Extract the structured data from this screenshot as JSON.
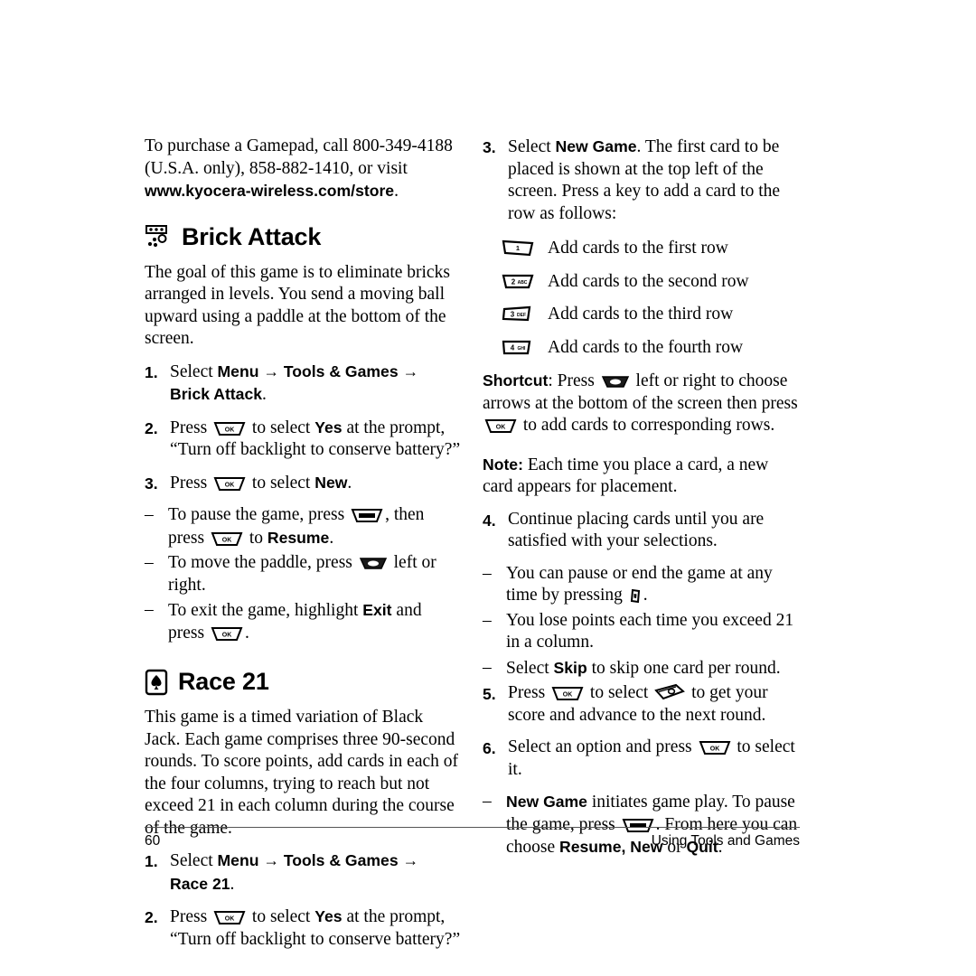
{
  "footer": {
    "page_number": "60",
    "running_head": "Using Tools and Games"
  },
  "left_column": {
    "intro": {
      "line1": "To purchase a Gamepad, call 800-349-4188",
      "line2": "(U.S.A. only), 858-882-1410, or visit",
      "url": "www.kyocera-wireless.com/store",
      "period": "."
    },
    "brick_attack": {
      "heading": "Brick Attack",
      "icon": "brick-attack-icon",
      "description": "The goal of this game is to eliminate bricks arranged in levels. You send a moving ball upward using a paddle at the bottom of the screen.",
      "steps": [
        {
          "marker": "1.",
          "pre": "Select ",
          "b1": "Menu",
          "arrow1": " → ",
          "b2": "Tools & Games",
          "arrow2": " → ",
          "b3": "Brick Attack",
          "post": "."
        },
        {
          "marker": "2.",
          "pre": "Press ",
          "key": "ok-key-icon",
          "mid": " to select ",
          "b1": "Yes",
          "post": " at the prompt, “Turn off backlight to conserve battery?”"
        },
        {
          "marker": "3.",
          "pre": "Press ",
          "key": "ok-key-icon",
          "mid": " to select ",
          "b1": "New",
          "post": "."
        }
      ],
      "sub_bullets": [
        {
          "marker": "–",
          "pre": "To pause the game, press ",
          "key1": "back-key-icon",
          "mid1": ", then press ",
          "key2": "ok-key-icon",
          "mid2": " to ",
          "b1": "Resume",
          "post": "."
        },
        {
          "marker": "–",
          "pre": "To move the paddle, press ",
          "key1": "nav-key-icon",
          "post": " left or right."
        },
        {
          "marker": "–",
          "pre": "To exit the game, highlight ",
          "b1": "Exit",
          "mid1": " and press ",
          "key1": "ok-key-icon",
          "post": "."
        }
      ]
    },
    "race21": {
      "heading": "Race 21",
      "icon": "spade-card-icon",
      "description": "This game is a timed variation of Black Jack. Each game comprises three 90-second rounds. To score points, add cards in each of the four columns, trying to reach but not exceed 21 in each column during the course of the game.",
      "steps": [
        {
          "marker": "1.",
          "pre": "Select ",
          "b1": "Menu",
          "arrow1": " → ",
          "b2": "Tools & Games",
          "arrow2": " → ",
          "b3": "Race 21",
          "post": "."
        },
        {
          "marker": "2.",
          "pre": "Press ",
          "key": "ok-key-icon",
          "mid": " to select ",
          "b1": "Yes",
          "post": " at the prompt, “Turn off backlight to conserve battery?”"
        }
      ]
    }
  },
  "right_column": {
    "step3": {
      "marker": "3.",
      "pre": "Select ",
      "b1": "New Game",
      "post": ". The first card to be placed is shown at the top left of the screen. Press a key to add a card to the row as follows:"
    },
    "key_rows": [
      {
        "key": "key-1-icon",
        "digit": "1",
        "sub": "",
        "text": "Add cards to the first row"
      },
      {
        "key": "key-2-icon",
        "digit": "2",
        "sub": "ABC",
        "text": "Add cards to the second row"
      },
      {
        "key": "key-3-icon",
        "digit": "3",
        "sub": "DEF",
        "text": "Add cards to the third row"
      },
      {
        "key": "key-4-icon",
        "digit": "4",
        "sub": "GHI",
        "text": "Add cards to the fourth row"
      }
    ],
    "shortcut": {
      "label": "Shortcut",
      "colon": ": Press ",
      "key1": "nav-key-icon",
      "mid": " left or right to choose arrows at the bottom of the screen then press ",
      "key2": "ok-key-icon",
      "post": " to add cards to corresponding rows."
    },
    "note": {
      "label": "Note:",
      "text": " Each time you place a card, a new card appears for placement."
    },
    "step4": {
      "marker": "4.",
      "text": "Continue placing cards until you are satisfied with your selections."
    },
    "step4_bullets": [
      {
        "marker": "–",
        "pre": "You can pause or end the game at any time by pressing ",
        "key1": "end-key-icon",
        "post": "."
      },
      {
        "marker": "–",
        "pre": "You lose points each time you exceed 21 in a column."
      },
      {
        "marker": "–",
        "pre": "Select ",
        "b1": "Skip",
        "post": " to skip one card per round."
      }
    ],
    "step5": {
      "marker": "5.",
      "pre": "Press ",
      "key1": "ok-key-icon",
      "mid": " to select ",
      "key2": "money-icon",
      "post": " to get your score and advance to the next round."
    },
    "step6": {
      "marker": "6.",
      "pre": "Select an option and press ",
      "key1": "ok-key-icon",
      "post": " to select it."
    },
    "step6_bullets": [
      {
        "marker": "–",
        "b1": "New Game",
        "mid1": " initiates game play. To pause the game, press ",
        "key1": "back-key-icon",
        "mid2": ". From here you can choose ",
        "b2": "Resume, New",
        "mid3": " or ",
        "b3": "Quit",
        "post": "."
      }
    ]
  }
}
